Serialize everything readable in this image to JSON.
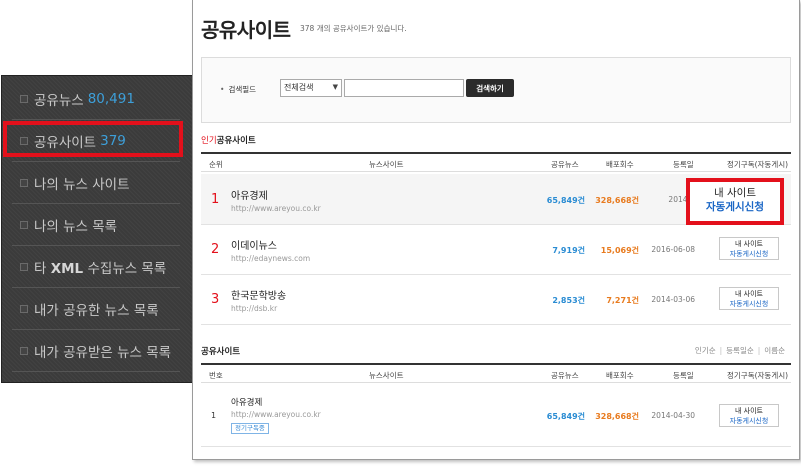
{
  "sidebar": {
    "items": [
      {
        "label": "공유뉴스",
        "count": "80,491"
      },
      {
        "label": "공유사이트",
        "count": "379"
      },
      {
        "label": "나의 뉴스 사이트",
        "count": ""
      },
      {
        "label": "나의 뉴스 목록",
        "count": ""
      },
      {
        "label_pre": "타 ",
        "label_bold": "XML",
        "label_post": " 수집뉴스 목록"
      },
      {
        "label": "내가 공유한 뉴스 목록",
        "count": ""
      },
      {
        "label": "내가 공유받은 뉴스 목록",
        "count": ""
      }
    ]
  },
  "page": {
    "title": "공유사이트",
    "subtitle": "378 개의 공유사이트가 있습니다."
  },
  "search": {
    "label": "검색필드",
    "select_value": "전체검색",
    "input_value": "",
    "button_label": "검색하기"
  },
  "popular": {
    "title_red": "인기",
    "title_rest": "공유사이트",
    "columns": [
      "순위",
      "뉴스사이트",
      "공유뉴스",
      "배포회수",
      "등록일",
      "정기구독(자동게시)"
    ],
    "rows": [
      {
        "rank": "1",
        "name": "아유경제",
        "url": "http://www.areyou.co.kr",
        "news": "65,849건",
        "dist": "328,668건",
        "date": "2014-0",
        "btn1": "내 사이트",
        "btn2": "자동게시신청"
      },
      {
        "rank": "2",
        "name": "이데이뉴스",
        "url": "http://edaynews.com",
        "news": "7,919건",
        "dist": "15,069건",
        "date": "2016-06-08",
        "btn1": "내 사이트",
        "btn2": "자동게시신청"
      },
      {
        "rank": "3",
        "name": "한국문학방송",
        "url": "http://dsb.kr",
        "news": "2,853건",
        "dist": "7,271건",
        "date": "2014-03-06",
        "btn1": "내 사이트",
        "btn2": "자동게시신청"
      }
    ]
  },
  "shared": {
    "title": "공유사이트",
    "sort_links": [
      "인기순",
      "등록일순",
      "이름순"
    ],
    "columns": [
      "번호",
      "뉴스사이트",
      "공유뉴스",
      "배포회수",
      "등록일",
      "정기구독(자동게시)"
    ],
    "rows": [
      {
        "no": "1",
        "name": "아유경제",
        "url": "http://www.areyou.co.kr",
        "tag": "정기구독중",
        "news": "65,849건",
        "dist": "328,668건",
        "date": "2014-04-30",
        "btn1": "내 사이트",
        "btn2": "자동게시신청"
      }
    ]
  },
  "colors": {
    "highlight_red": "#e3101b",
    "news_blue": "#2a8cd3",
    "dist_orange": "#e87b1f",
    "count_blue": "#3d9fd9"
  }
}
